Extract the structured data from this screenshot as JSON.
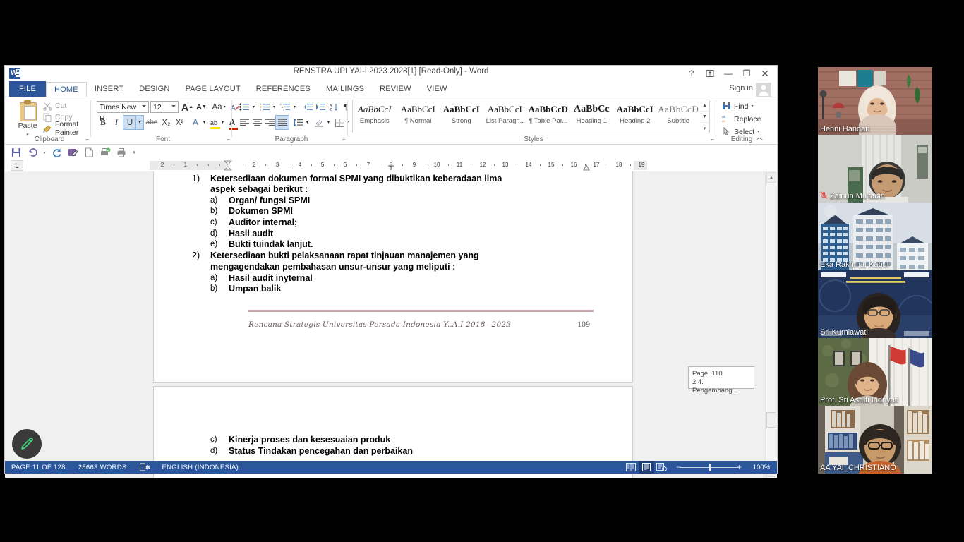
{
  "window": {
    "title": "RENSTRA UPI YAI-I 2023 2028[1] [Read-Only] - Word",
    "app_icon": "word-icon",
    "help_btn": "?",
    "ribbon_display_btn": "▣",
    "minimize_btn": "—",
    "restore_btn": "❐",
    "close_btn": "✕",
    "sign_in": "Sign in"
  },
  "tabs": [
    {
      "label": "FILE",
      "id": "file"
    },
    {
      "label": "HOME",
      "id": "home"
    },
    {
      "label": "INSERT",
      "id": "insert"
    },
    {
      "label": "DESIGN",
      "id": "design"
    },
    {
      "label": "PAGE LAYOUT",
      "id": "page-layout"
    },
    {
      "label": "REFERENCES",
      "id": "references"
    },
    {
      "label": "MAILINGS",
      "id": "mailings"
    },
    {
      "label": "REVIEW",
      "id": "review"
    },
    {
      "label": "VIEW",
      "id": "view"
    }
  ],
  "ribbon": {
    "clipboard": {
      "group_label": "Clipboard",
      "paste_label": "Paste",
      "cut_label": "Cut",
      "copy_label": "Copy",
      "format_painter_label": "Format Painter"
    },
    "font": {
      "group_label": "Font",
      "font_name": "Times New R",
      "font_size": "12",
      "grow_font": "A",
      "shrink_font": "A",
      "change_case": "Aa",
      "clear_formatting": "clear-formatting-icon",
      "bold": "B",
      "italic": "I",
      "underline": "U",
      "strikethrough": "abe",
      "subscript": "X₂",
      "superscript": "X²",
      "text_effects": "A",
      "highlight": "ab",
      "font_color": "A"
    },
    "paragraph": {
      "group_label": "Paragraph",
      "bullets": "bullets-icon",
      "numbering": "numbering-icon",
      "multilevel": "multilevel-list-icon",
      "decrease_indent": "decrease-indent-icon",
      "increase_indent": "increase-indent-icon",
      "sort": "sort-icon",
      "show_marks": "¶",
      "align_left": "align-left-icon",
      "align_center": "align-center-icon",
      "align_right": "align-right-icon",
      "justify": "justify-icon",
      "line_spacing": "line-spacing-icon",
      "shading": "shading-icon",
      "borders": "borders-icon"
    },
    "styles": {
      "group_label": "Styles",
      "items": [
        {
          "preview": "AaBbCcI",
          "label": "Emphasis",
          "style": "italic"
        },
        {
          "preview": "AaBbCcI",
          "label": "¶ Normal",
          "style": "normal"
        },
        {
          "preview": "AaBbCcI",
          "label": "Strong",
          "style": "bold"
        },
        {
          "preview": "AaBbCcI",
          "label": "List Paragr...",
          "style": "normal"
        },
        {
          "preview": "AaBbCcD",
          "label": "¶ Table Par...",
          "style": "bold"
        },
        {
          "preview": "AaBbCc",
          "label": "Heading 1",
          "style": "bold"
        },
        {
          "preview": "AaBbCcI",
          "label": "Heading 2",
          "style": "bold"
        },
        {
          "preview": "AaBbCcD",
          "label": "Subtitle",
          "style": "light"
        }
      ]
    },
    "editing": {
      "group_label": "Editing",
      "find_label": "Find",
      "replace_label": "Replace",
      "select_label": "Select"
    }
  },
  "quick_access": {
    "save": "save-icon",
    "undo": "undo-icon",
    "redo": "redo-icon",
    "edit": "edit-icon",
    "new": "new-doc-icon",
    "print_preview": "print-preview-icon",
    "quick_print": "quick-print-icon",
    "customize": "customize-qat-icon"
  },
  "ruler": {
    "tab_selector": "L",
    "marks": [
      "2",
      "1",
      "1",
      "2",
      "3",
      "4",
      "5",
      "6",
      "7",
      "8",
      "9",
      "10",
      "11",
      "12",
      "13",
      "14",
      "15",
      "16",
      "17",
      "18",
      "19"
    ]
  },
  "document": {
    "page1": {
      "lines": [
        {
          "mk": "1)",
          "text": "Ketersediaan dokumen formal SPMI yang dibuktikan keberadaan lima"
        },
        {
          "mk": "",
          "text": "aspek sebagai berikut :"
        },
        {
          "mk": "a)",
          "text": "Organ/ fungsi SPMI"
        },
        {
          "mk": "b)",
          "text": "Dokumen SPMI"
        },
        {
          "mk": "c)",
          "text": "Auditor internal;"
        },
        {
          "mk": "d)",
          "text": "Hasil audit"
        },
        {
          "mk": "e)",
          "text": "Bukti tuindak lanjut."
        },
        {
          "mk": "2)",
          "text": "Ketersediaan  bukti  pelaksanaan  rapat  tinjauan  manajemen  yang"
        },
        {
          "mk": "",
          "text": "mengagendakan  pembahasan unsur-unsur yang meliputi :"
        },
        {
          "mk": "a)",
          "text": "Hasil audit inyternal"
        },
        {
          "mk": "b)",
          "text": "Umpan balik"
        }
      ],
      "footer_text": "Rencana Strategis Universitas Persada Indonesia Y..A.I 2018– 2023",
      "footer_page": "109"
    },
    "page2": {
      "lines": [
        {
          "mk": "c)",
          "text": "Kinerja proses dan kesesuaian produk"
        },
        {
          "mk": "d)",
          "text": "Status Tindakan pencegahan dan perbaikan"
        }
      ]
    },
    "page_tooltip": {
      "line1": "Page: 110",
      "line2": "2.4. Pengembang..."
    }
  },
  "status_bar": {
    "page_info": "PAGE 11 OF 128",
    "word_count": "28663 WORDS",
    "proofing_icon": "spell-check-icon",
    "language": "ENGLISH (INDONESIA)",
    "read_mode": "read-mode-icon",
    "print_layout": "print-layout-icon",
    "web_layout": "web-layout-icon",
    "zoom_out": "−",
    "zoom_in": "+",
    "zoom_level": "100%"
  },
  "annotation": {
    "pen_button": "pen-icon",
    "pen_color": "#3fd07a"
  },
  "video_panel": {
    "participants": [
      {
        "name": "Henni Handari",
        "muted": false,
        "active": false,
        "scene": "brick-room-woman"
      },
      {
        "name": "Zainun Mu'tadin",
        "muted": true,
        "active": false,
        "scene": "office-man"
      },
      {
        "name": "Eka Rakhmat Kabul",
        "muted": false,
        "active": true,
        "scene": "building-slide"
      },
      {
        "name": "Sri Kurniawati",
        "muted": false,
        "active": false,
        "scene": "presentation-woman"
      },
      {
        "name": "Prof. Sri Astuti Indriyati",
        "muted": false,
        "active": false,
        "scene": "flag-room-woman"
      },
      {
        "name": "AA YAI_CHRISTIANO",
        "muted": false,
        "active": false,
        "scene": "bookshelf-man"
      }
    ],
    "active_border_color": "#c8e55b"
  }
}
